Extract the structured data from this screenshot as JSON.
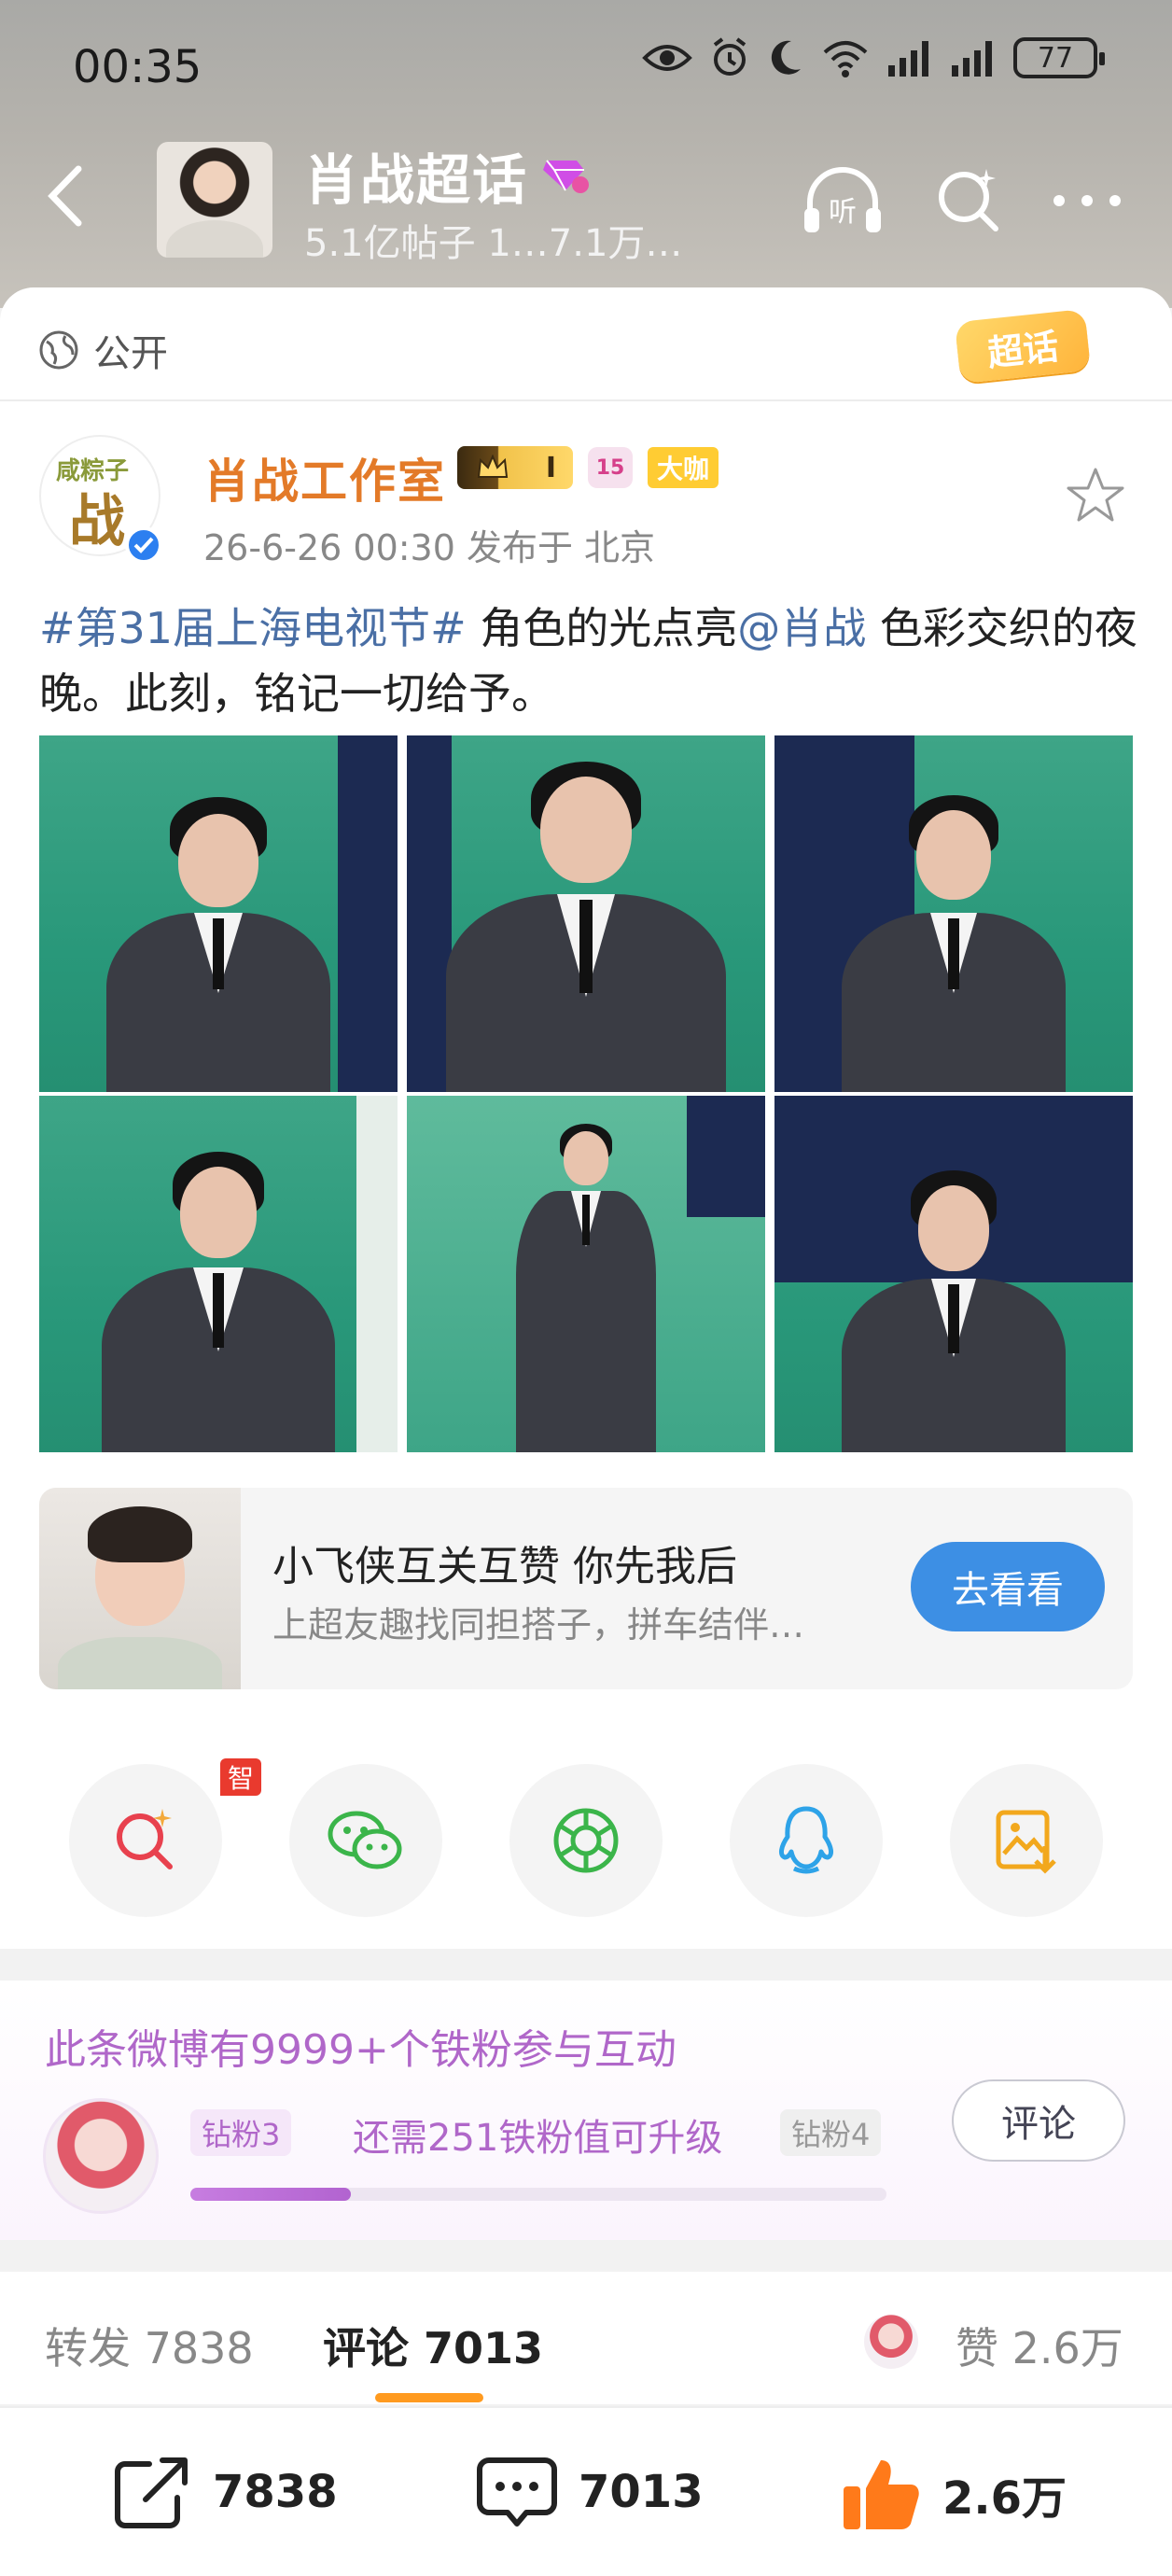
{
  "status_bar": {
    "time": "00:35",
    "battery": "77"
  },
  "topic": {
    "title": "肖战超话",
    "subtitle": "5.1亿帖子 1…7.1万…"
  },
  "visibility": {
    "label": "公开"
  },
  "badge_label": "超话",
  "post": {
    "author": "肖战工作室",
    "avatar_text_top": "咸粽子",
    "avatar_text_main": "战",
    "crown_badge": "I",
    "level_badge": "15",
    "daka_badge": "大咖",
    "meta": "26-6-26 00:30  发布于 北京",
    "text_tag": "#第31届上海电视节#",
    "text_part1": " 角色的光点亮",
    "text_mention": "@肖战",
    "text_part2": " 色彩交织的夜晚。此刻，铭记一切给予。",
    "photo_count": 6
  },
  "promo": {
    "title": "小飞侠互关互赞 你先我后",
    "subtitle": "上超友趣找同担搭子，拼车结伴…",
    "button": "去看看"
  },
  "share": {
    "badge": "问智搜",
    "items": [
      "wenzhisou-search",
      "wechat",
      "moments",
      "qq",
      "save-image"
    ]
  },
  "fans": {
    "title": "此条微博有9999+个铁粉参与互动",
    "current_tier": "钻粉3",
    "next_tier": "钻粉4",
    "need_text": "还需251铁粉值可升级",
    "progress_fraction": 0.23,
    "button": "评论"
  },
  "tabs": {
    "repost_label": "转发 7838",
    "comment_label": "评论 7013",
    "like_label": "赞 2.6万"
  },
  "bottom": {
    "repost": "7838",
    "comment": "7013",
    "like": "2.6万"
  },
  "colors": {
    "accent_orange": "#e37a28",
    "link_blue": "#4a6fa5",
    "fans_purple": "#b067c9",
    "button_blue": "#3d8fe4"
  }
}
